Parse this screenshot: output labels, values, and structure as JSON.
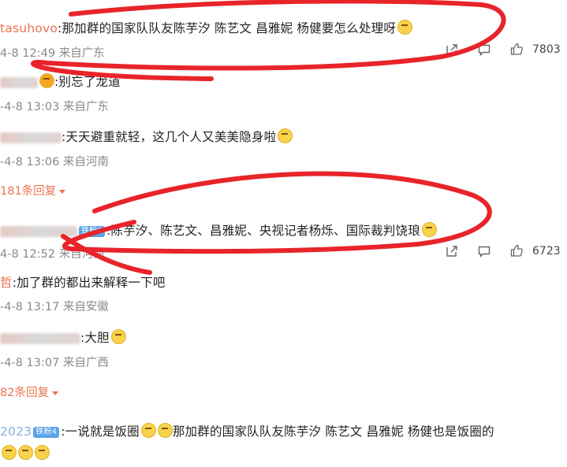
{
  "comments": [
    {
      "user": "tasuhovo",
      "text": ":那加群的国家队队友陈芋汐 陈艺文 昌雅妮 杨健要怎么处理呀",
      "meta": "4-8 12:49 来自广东",
      "likes": "7803"
    },
    {
      "user": "",
      "text": ":别忘了龙道",
      "meta": "-4-8 13:03 来自广东"
    },
    {
      "user": "",
      "text": ":天天避重就轻，这几个人又美美隐身啦",
      "meta": "-4-8 13:06 来自河南",
      "replies": "181条回复"
    },
    {
      "user": "",
      "badge": "铁粉3",
      "text": ":陈芋汐、陈艺文、昌雅妮、央视记者杨烁、国际裁判饶琅",
      "meta": "4-8 12:52 来自河南",
      "likes": "6723"
    },
    {
      "user": "哲",
      "text": ":加了群的都出来解释一下吧",
      "meta": "-4-8 13:17 来自安徽"
    },
    {
      "user": "",
      "text": ":大胆",
      "meta": "-4-8 13:07 来自广西",
      "replies": "82条回复"
    },
    {
      "user": "2023",
      "badge": "铁粉4",
      "text": ":一说就是饭圈",
      "text2": "那加群的国家队队友陈芋汐 陈艺文 昌雅妮 杨健也是饭圈的"
    }
  ],
  "colors": {
    "accent": "#eb7350",
    "annotation": "#e8242a",
    "badge": "#5aa2e8"
  },
  "icons": [
    "share-icon",
    "comment-icon",
    "like-icon",
    "emoji-icon"
  ]
}
